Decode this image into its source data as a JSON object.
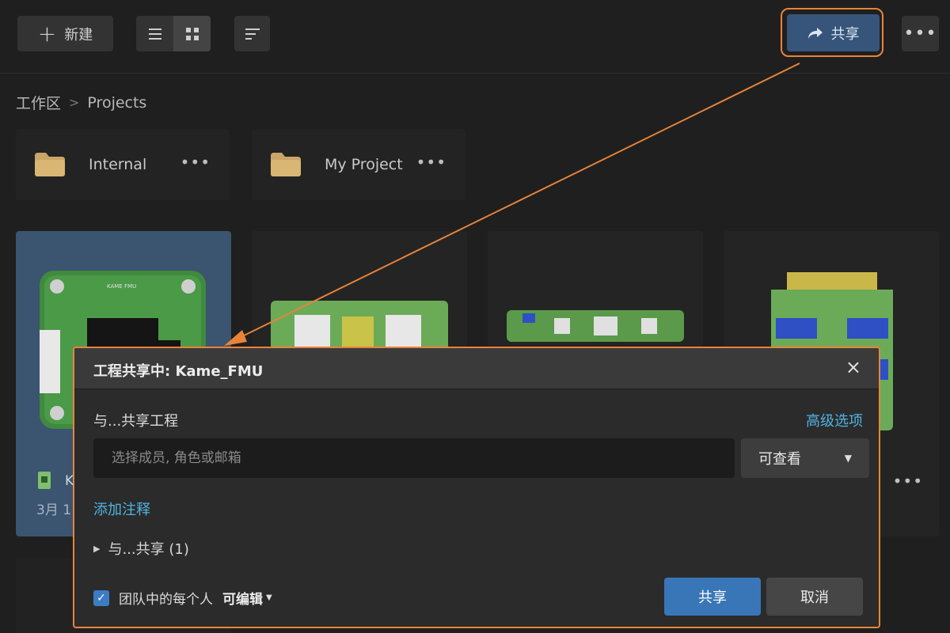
{
  "toolbar": {
    "new_label": "新建",
    "share_label": "共享",
    "more_label": "•••"
  },
  "breadcrumb": {
    "root": "工作区",
    "separator": ">",
    "current": "Projects"
  },
  "folders": [
    {
      "name": "Internal",
      "more": "•••"
    },
    {
      "name": "My Project",
      "more": "•••"
    }
  ],
  "project_cards": [
    {
      "name": "K",
      "date": "3月 1",
      "selected": true
    },
    {
      "more": "•••"
    }
  ],
  "dialog": {
    "title": "工程共享中: Kame_FMU",
    "close_label": "×",
    "share_with_label": "与...共享工程",
    "advanced_label": "高级选项",
    "member_placeholder": "选择成员, 角色或邮箱",
    "member_value": "",
    "role_value": "可查看",
    "add_note_label": "添加注释",
    "shared_with_label": "与...共享 (1)",
    "everyone_label": "团队中的每个人",
    "everyone_permission": "可编辑",
    "everyone_checked": true,
    "share_button": "共享",
    "cancel_button": "取消"
  },
  "icons": {
    "plus": "plus-icon",
    "list_view": "list-view-icon",
    "grid_view": "grid-view-icon",
    "sort": "sort-icon",
    "share": "share-arrow-icon",
    "more": "more-icon",
    "folder": "folder-icon",
    "close": "close-icon",
    "caret": "caret-down-icon",
    "checkbox": "checkbox-icon"
  },
  "colors": {
    "highlight_outline": "#e8843a",
    "accent_link": "#4fb3e3",
    "primary_button": "#3976b7",
    "selected_card": "#3b5470"
  }
}
